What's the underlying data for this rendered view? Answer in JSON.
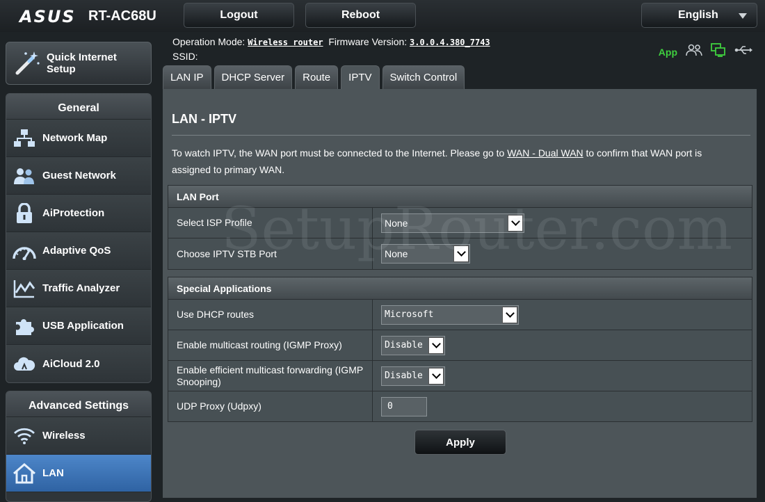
{
  "header": {
    "brand": "ASUS",
    "model": "RT-AC68U",
    "logout_label": "Logout",
    "reboot_label": "Reboot",
    "language": "English"
  },
  "sidebar": {
    "quick_setup": "Quick Internet Setup",
    "general_title": "General",
    "general_items": [
      {
        "label": "Network Map",
        "icon": "network-map-icon"
      },
      {
        "label": "Guest Network",
        "icon": "guest-network-icon"
      },
      {
        "label": "AiProtection",
        "icon": "lock-icon"
      },
      {
        "label": "Adaptive QoS",
        "icon": "speedometer-icon"
      },
      {
        "label": "Traffic Analyzer",
        "icon": "chart-icon"
      },
      {
        "label": "USB Application",
        "icon": "puzzle-icon"
      },
      {
        "label": "AiCloud 2.0",
        "icon": "cloud-icon"
      }
    ],
    "advanced_title": "Advanced Settings",
    "advanced_items": [
      {
        "label": "Wireless",
        "icon": "wifi-icon",
        "active": false
      },
      {
        "label": "LAN",
        "icon": "home-icon",
        "active": true
      }
    ]
  },
  "status": {
    "operation_mode_label": "Operation Mode:",
    "operation_mode": "Wireless router",
    "firmware_label": "Firmware Version:",
    "firmware": "3.0.0.4.380_7743",
    "ssid_label": "SSID:",
    "app_label": "App"
  },
  "tabs": [
    "LAN IP",
    "DHCP Server",
    "Route",
    "IPTV",
    "Switch Control"
  ],
  "active_tab": "IPTV",
  "page": {
    "title": "LAN - IPTV",
    "desc_pre": "To watch IPTV, the WAN port must be connected to the Internet. Please go to ",
    "desc_link": "WAN - Dual WAN",
    "desc_post": " to confirm that WAN port is assigned to primary WAN."
  },
  "lan_port": {
    "title": "LAN Port",
    "isp_profile_label": "Select ISP Profile",
    "isp_profile_value": "None",
    "stb_port_label": "Choose IPTV STB Port",
    "stb_port_value": "None"
  },
  "special": {
    "title": "Special Applications",
    "dhcp_routes_label": "Use DHCP routes",
    "dhcp_routes_value": "Microsoft",
    "igmp_proxy_label": "Enable multicast routing (IGMP Proxy)",
    "igmp_proxy_value": "Disable",
    "igmp_snooping_label": "Enable efficient multicast forwarding (IGMP Snooping)",
    "igmp_snooping_value": "Disable",
    "udpxy_label": "UDP Proxy (Udpxy)",
    "udpxy_value": "0"
  },
  "apply_label": "Apply",
  "watermark": "SetupRouter.com"
}
